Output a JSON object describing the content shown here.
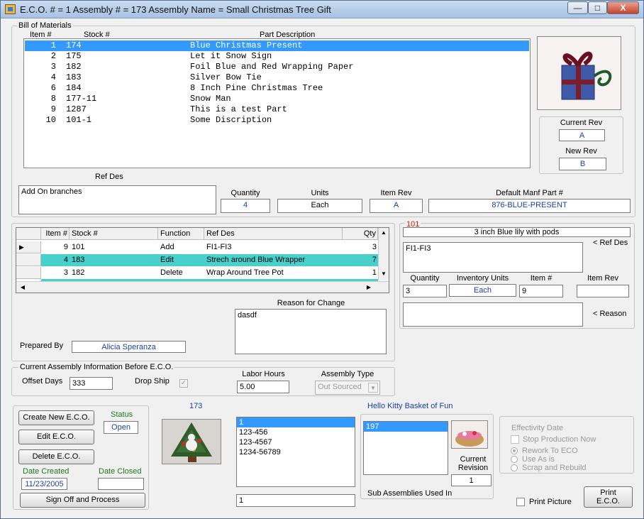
{
  "window": {
    "title": "E.C.O. # = 1 Assembly # = 173 Assembly Name = Small Christmas Tree Gift",
    "minimize": "—",
    "maximize": "□",
    "close": "X"
  },
  "bom": {
    "group_title": "Bill of Materials",
    "col_item": "Item #",
    "col_stock": "Stock #",
    "col_desc": "Part Description",
    "rows": [
      {
        "item": "1",
        "stock": "174",
        "desc": "Blue Christmas Present"
      },
      {
        "item": "2",
        "stock": "175",
        "desc": "Let it Snow Sign"
      },
      {
        "item": "3",
        "stock": "182",
        "desc": "Foil Blue and Red Wrapping Paper"
      },
      {
        "item": "4",
        "stock": "183",
        "desc": "Silver Bow Tie"
      },
      {
        "item": "6",
        "stock": "184",
        "desc": "8 Inch Pine Christmas Tree"
      },
      {
        "item": "8",
        "stock": "177-11",
        "desc": "Snow Man"
      },
      {
        "item": "9",
        "stock": "1287",
        "desc": "This is a test Part"
      },
      {
        "item": "10",
        "stock": "101-1",
        "desc": "Some Discription"
      }
    ],
    "ref_des_label": "Ref Des",
    "ref_des_value": "Add On branches",
    "quantity_label": "Quantity",
    "quantity_value": "4",
    "units_label": "Units",
    "units_value": "Each",
    "item_rev_label": "Item Rev",
    "item_rev_value": "A",
    "manf_label": "Default Manf Part #",
    "manf_value": "876-BLUE-PRESENT"
  },
  "rev": {
    "current_label": "Current Rev",
    "current_value": "A",
    "new_label": "New Rev",
    "new_value": "B"
  },
  "changes_grid": {
    "headers": [
      "Item #",
      "Stock #",
      "Function",
      "Ref Des",
      "Qty"
    ],
    "rows": [
      {
        "item": "9",
        "stock": "101",
        "function": "Add",
        "ref_des": "FI1-FI3",
        "qty": "3"
      },
      {
        "item": "4",
        "stock": "183",
        "function": "Edit",
        "ref_des": "Strech around Blue Wrapper",
        "qty": "7"
      },
      {
        "item": "3",
        "stock": "182",
        "function": "Delete",
        "ref_des": "Wrap Around Tree Pot",
        "qty": "1"
      }
    ],
    "row_indicator": "▶"
  },
  "detail": {
    "stock_no": "101",
    "description": "3 inch Blue lily with pods",
    "ref_des_value": "FI1-FI3",
    "ref_des_label": "< Ref Des",
    "quantity_label": "Quantity",
    "quantity_value": "3",
    "inv_units_label": "Inventory Units",
    "inv_units_value": "Each",
    "item_no_label": "Item #",
    "item_no_value": "9",
    "item_rev_label": "Item Rev",
    "item_rev_value": "",
    "reason_label": "< Reason",
    "reason_value": ""
  },
  "reason": {
    "label": "Reason for Change",
    "value": "dasdf",
    "prepared_by_label": "Prepared By",
    "prepared_by_value": "Alicia Speranza"
  },
  "assembly_info": {
    "group_title": "Current Assembly Information Before E.C.O.",
    "offset_days_label": "Offset Days",
    "offset_days_value": "333",
    "drop_ship_label": "Drop Ship",
    "drop_ship_mark": "✓",
    "labor_hours_label": "Labor Hours",
    "labor_hours_value": "5.00",
    "assembly_type_label": "Assembly Type",
    "assembly_type_value": "Out Sourced",
    "dropdown_arrow": "▼"
  },
  "eco": {
    "create_label": "Create New E.C.O.",
    "edit_label": "Edit E.C.O.",
    "delete_label": "Delete E.C.O.",
    "status_label": "Status",
    "status_value": "Open",
    "date_created_label": "Date Created",
    "date_created_value": "11/23/2005",
    "date_closed_label": "Date Closed",
    "date_closed_value": "",
    "sign_off_label": "Sign Off and Process"
  },
  "assembly": {
    "number": "173",
    "name": "Hello Kitty Basket of Fun",
    "list_items": [
      "1",
      "123-456",
      "123-4567",
      "1234-56789"
    ],
    "list_input": "1",
    "sub_assemblies": [
      "197"
    ],
    "sub_assemblies_label": "Sub Assemblies Used In",
    "current_revision_label": "Current Revision",
    "current_revision_value": "1"
  },
  "effectivity": {
    "title": "Effectivity Date",
    "stop_production": "Stop Production Now",
    "rework": "Rework To ECO",
    "use_as_is": "Use As is",
    "scrap": "Scrap and Rebuild"
  },
  "print": {
    "print_picture_label": "Print Picture",
    "print_eco_label": "Print E.C.O."
  },
  "colors": {
    "selection": "#3399ff",
    "grid_highlight": "#48d1cc",
    "value_blue": "#1a3fa8",
    "label_green": "#1d7a1d",
    "stock_no_red": "#cc2200"
  }
}
